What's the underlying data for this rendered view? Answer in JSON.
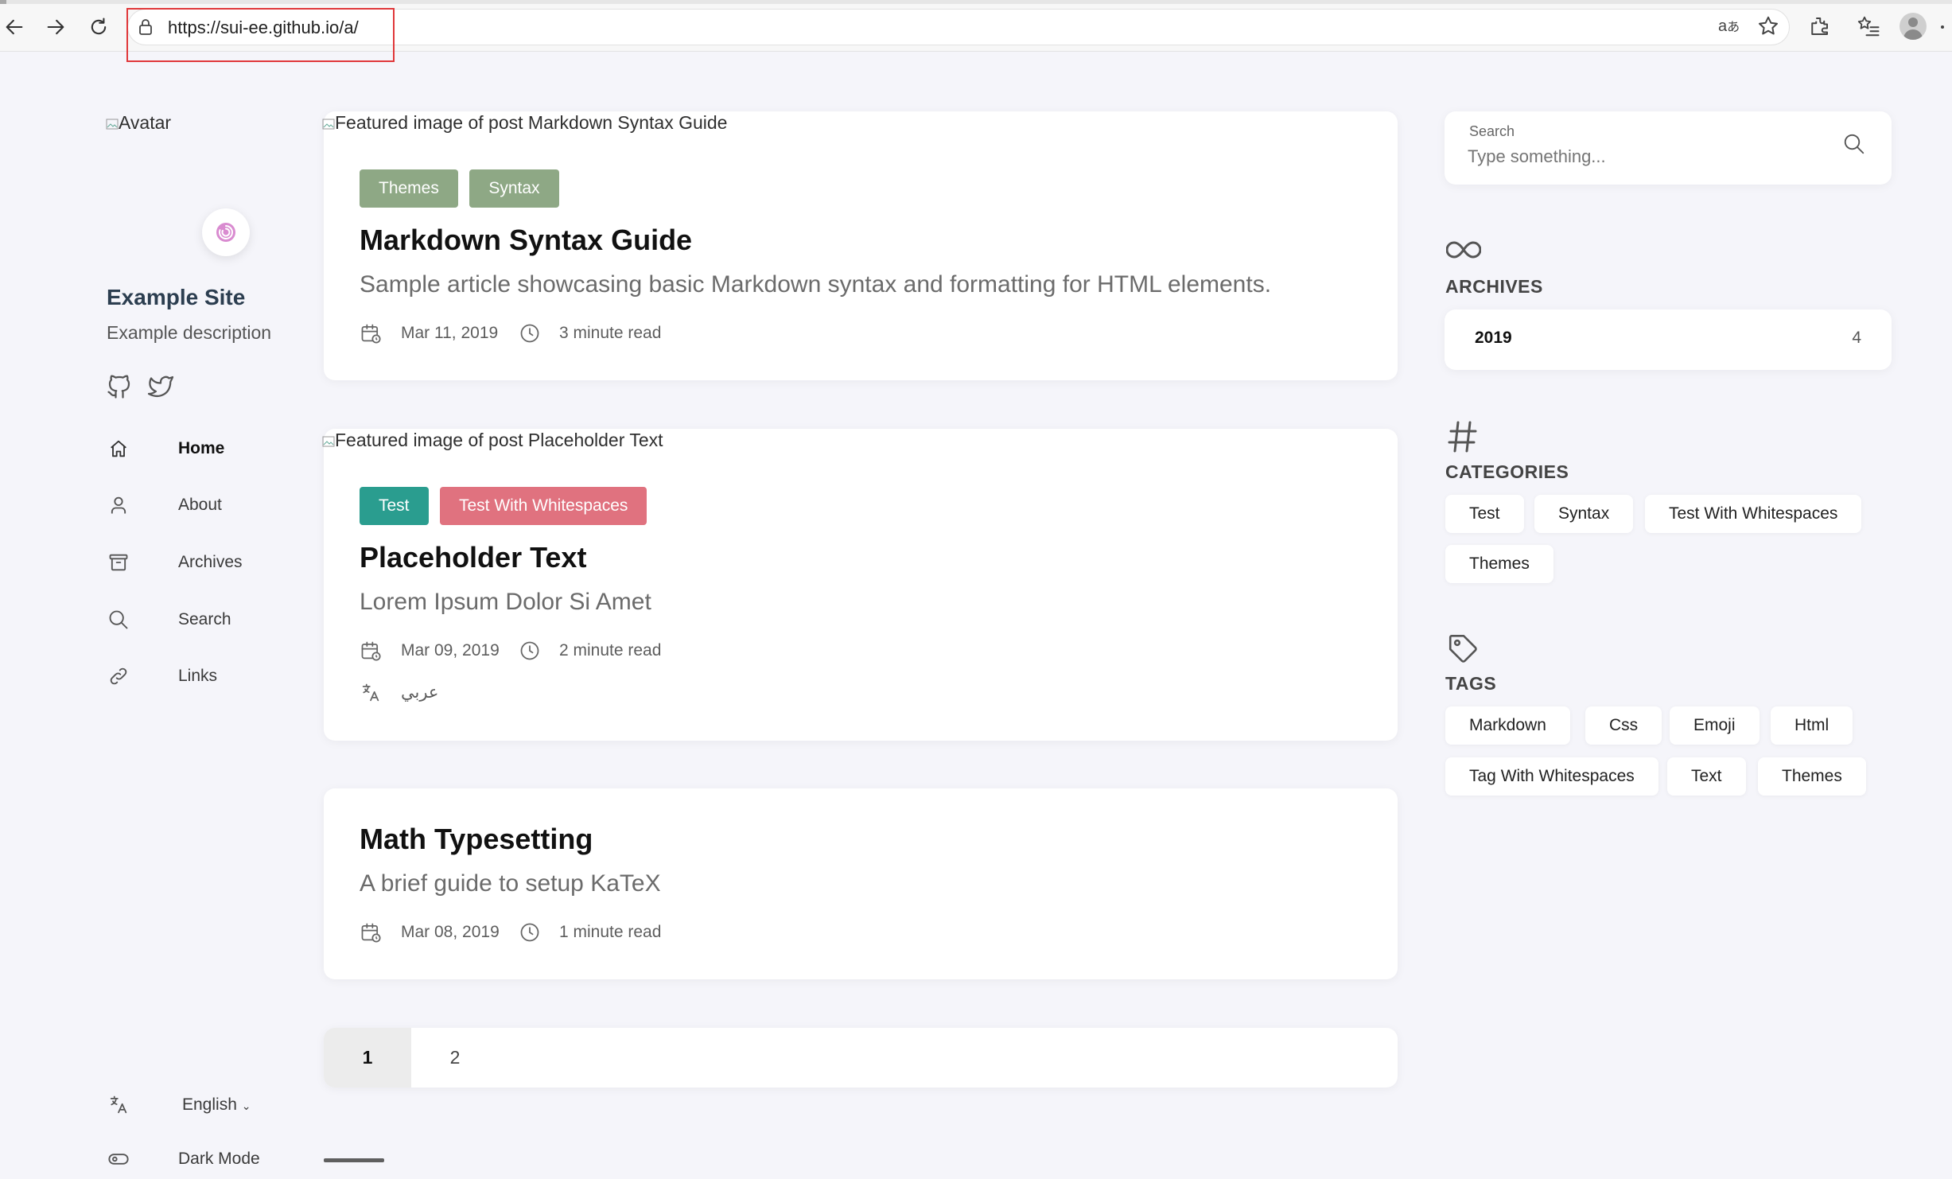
{
  "browser": {
    "url": "https://sui-ee.github.io/a/"
  },
  "sidebar": {
    "avatar_alt": "Avatar",
    "site_title": "Example Site",
    "site_description": "Example description",
    "menu": [
      {
        "label": "Home",
        "icon": "home-icon"
      },
      {
        "label": "About",
        "icon": "user-icon"
      },
      {
        "label": "Archives",
        "icon": "archive-icon"
      },
      {
        "label": "Search",
        "icon": "search-icon"
      },
      {
        "label": "Links",
        "icon": "link-icon"
      }
    ],
    "language_label": "English",
    "dark_mode_label": "Dark Mode"
  },
  "posts": [
    {
      "featured_alt": "Featured image of post Markdown Syntax Guide",
      "categories": [
        {
          "label": "Themes",
          "color": "#8ea885"
        },
        {
          "label": "Syntax",
          "color": "#8ea885"
        }
      ],
      "title": "Markdown Syntax Guide",
      "subtitle": "Sample article showcasing basic Markdown syntax and formatting for HTML elements.",
      "date": "Mar 11, 2019",
      "read_time": "3 minute read"
    },
    {
      "featured_alt": "Featured image of post Placeholder Text",
      "categories": [
        {
          "label": "Test",
          "color": "#2a9d8f"
        },
        {
          "label": "Test With Whitespaces",
          "color": "#e0727f"
        }
      ],
      "title": "Placeholder Text",
      "subtitle": "Lorem Ipsum Dolor Si Amet",
      "date": "Mar 09, 2019",
      "read_time": "2 minute read",
      "translation": "عربي"
    },
    {
      "title": "Math Typesetting",
      "subtitle": "A brief guide to setup KaTeX",
      "date": "Mar 08, 2019",
      "read_time": "1 minute read"
    }
  ],
  "pagination": [
    "1",
    "2"
  ],
  "right_sidebar": {
    "search_label": "Search",
    "search_placeholder": "Type something...",
    "archives_title": "ARCHIVES",
    "archives": [
      {
        "year": "2019",
        "count": "4"
      }
    ],
    "categories_title": "CATEGORIES",
    "categories": [
      "Test",
      "Syntax",
      "Test With Whitespaces",
      "Themes"
    ],
    "tags_title": "TAGS",
    "tags": [
      "Markdown",
      "Css",
      "Emoji",
      "Html",
      "Tag With Whitespaces",
      "Text",
      "Themes"
    ]
  }
}
